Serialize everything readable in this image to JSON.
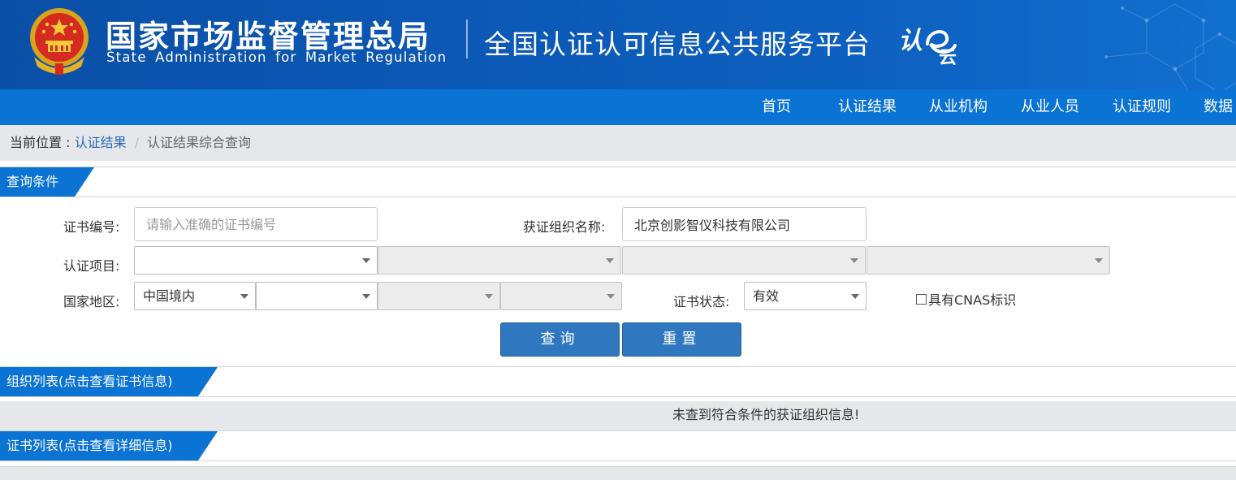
{
  "header": {
    "org_name_cn": "国家市场监督管理总局",
    "org_name_en": "State Administration  for  Market Regulation",
    "platform_title": "全国认证认可信息公共服务平台",
    "platform_logo": "认e云"
  },
  "nav": {
    "items": [
      {
        "label": "首页"
      },
      {
        "label": "认证结果"
      },
      {
        "label": "从业机构"
      },
      {
        "label": "从业人员"
      },
      {
        "label": "认证规则"
      },
      {
        "label": "数据"
      }
    ]
  },
  "breadcrumb": {
    "prefix": "当前位置 : ",
    "link": "认证结果",
    "separator": "/",
    "current": "认证结果综合查询"
  },
  "query_section": {
    "title": "查询条件",
    "cert_no_label": "证书编号:",
    "cert_no_placeholder": "请输入准确的证书编号",
    "cert_no_value": "",
    "org_name_label": "获证组织名称:",
    "org_name_value": "北京创影智仪科技有限公司",
    "project_label": "认证项目:",
    "project_selects": [
      "",
      "",
      "",
      ""
    ],
    "region_label": "国家地区:",
    "region_selects": [
      "中国境内",
      "",
      "",
      ""
    ],
    "status_label": "证书状态:",
    "status_value": "有效",
    "cnas_label": "具有CNAS标识",
    "cnas_checked": false,
    "search_button": "查询",
    "reset_button": "重置"
  },
  "org_list": {
    "title": "组织列表(点击查看证书信息)",
    "empty_message": "未查到符合条件的获证组织信息!"
  },
  "cert_list": {
    "title": "证书列表(点击查看详细信息)"
  },
  "colors": {
    "banner": "#0c5ab8",
    "nav": "#0a73d4",
    "button": "#2f78bf",
    "link": "#2a6bb5",
    "gray_bg": "#e5e7ea"
  }
}
